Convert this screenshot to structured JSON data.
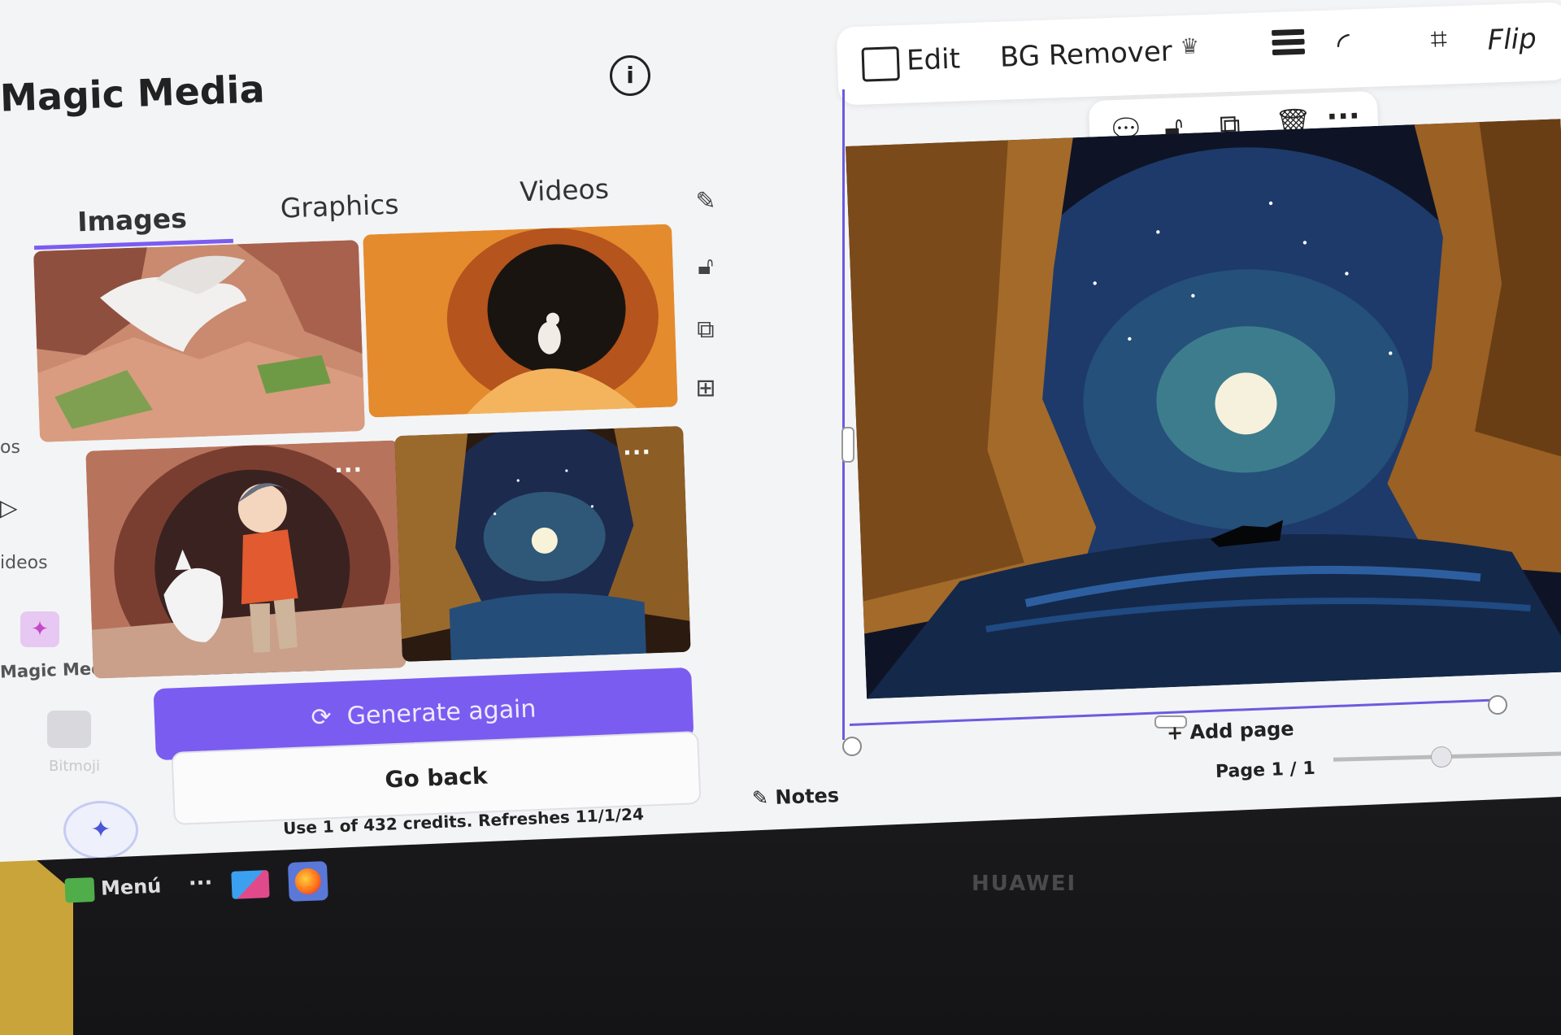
{
  "panel": {
    "title": "Magic Media",
    "tabs": [
      {
        "label": "Images",
        "active": true
      },
      {
        "label": "Graphics",
        "active": false
      },
      {
        "label": "Videos",
        "active": false
      }
    ],
    "generate_label": "Generate again",
    "back_label": "Go back",
    "credits_text": "Use 1 of 432 credits. Refreshes 11/1/24"
  },
  "left_rail": {
    "items": [
      {
        "label": "os"
      },
      {
        "label": "ideos"
      },
      {
        "label": "Magic Media"
      }
    ],
    "faint_label": "Bitmoji"
  },
  "editor": {
    "toolbar": {
      "edit_label": "Edit",
      "bg_remover_label": "BG Remover",
      "flip_label": "Flip"
    },
    "add_page_label": "+ Add page",
    "page_indicator": "Page 1 / 1",
    "notes_label": "Notes"
  },
  "taskbar": {
    "menu_label": "Menú"
  },
  "device_brand": "HUAWEI",
  "colors": {
    "accent": "#7b5cf0",
    "selection": "#6b5be0"
  },
  "icons": [
    "info-icon",
    "edit-image-icon",
    "crown-icon",
    "lines-icon",
    "corner-curve-icon",
    "crop-icon",
    "comment-add-icon",
    "lock-icon",
    "duplicate-icon",
    "trash-icon",
    "more-icon",
    "notes-icon",
    "sparkle-icon",
    "refresh-icon"
  ]
}
